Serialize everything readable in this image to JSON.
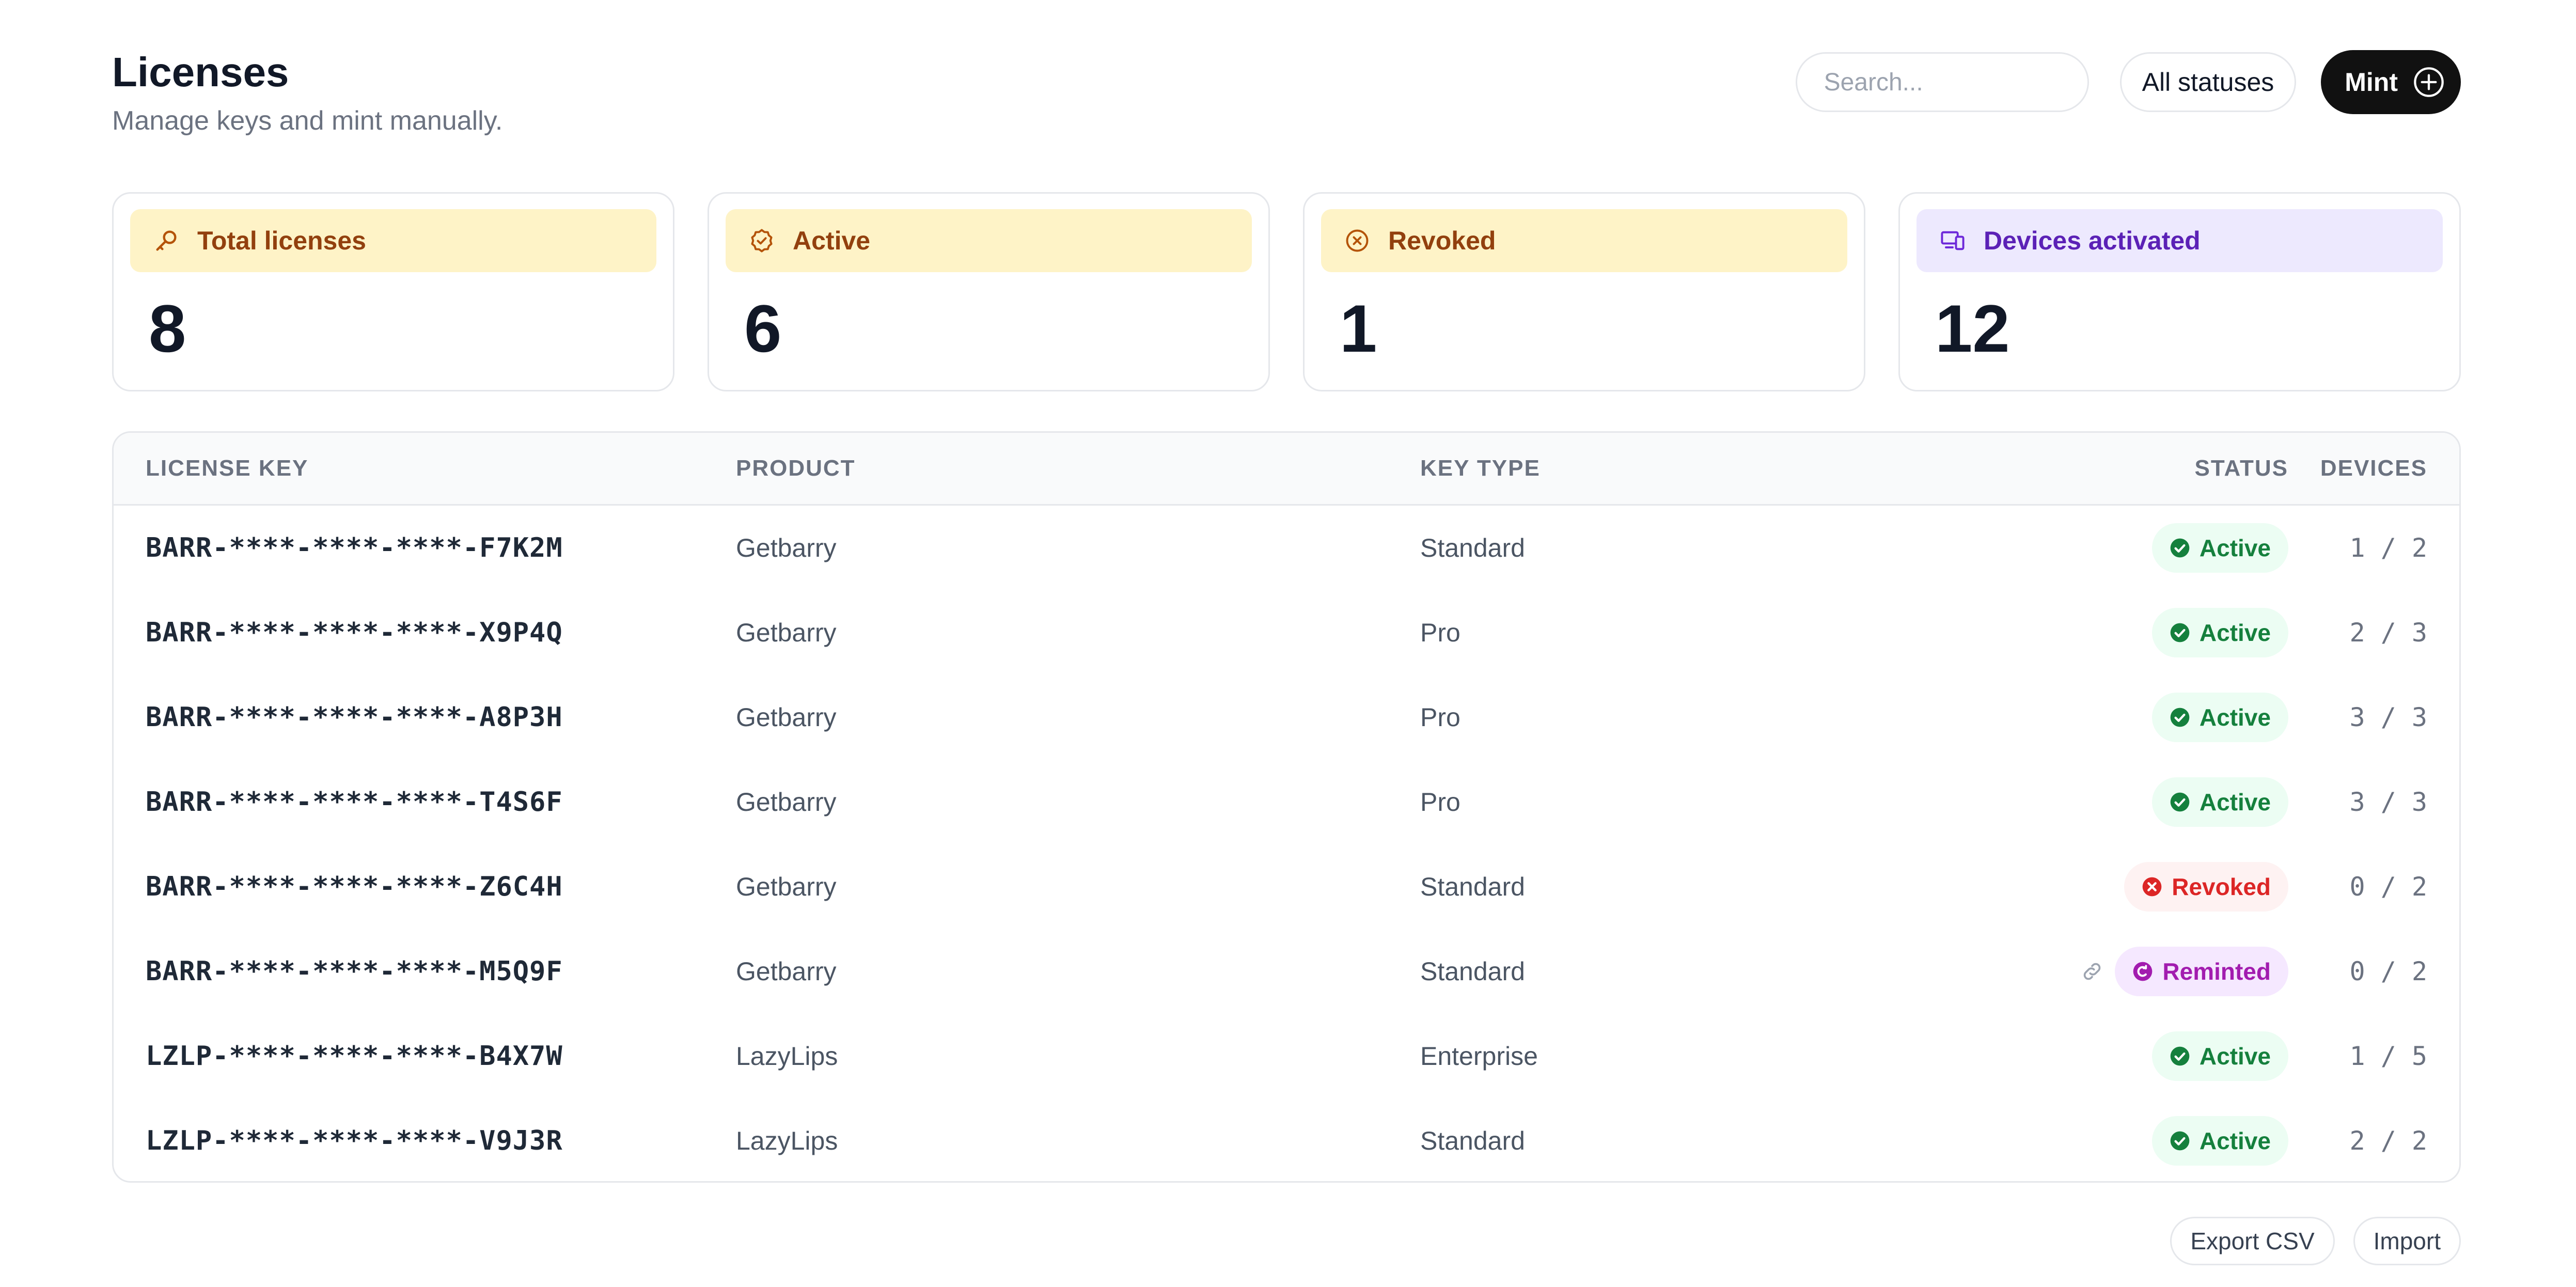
{
  "header": {
    "title": "Licenses",
    "subtitle": "Manage keys and mint manually."
  },
  "toolbar": {
    "search_placeholder": "Search...",
    "status_filter_label": "All statuses",
    "mint_label": "Mint"
  },
  "stats": [
    {
      "label": "Total licenses",
      "value": "8",
      "icon": "key-icon",
      "color": "#fef3c7"
    },
    {
      "label": "Active",
      "value": "6",
      "icon": "check-badge-icon",
      "color": "#fef3c7"
    },
    {
      "label": "Revoked",
      "value": "1",
      "icon": "x-circle-icon",
      "color": "#fef3c7"
    },
    {
      "label": "Devices activated",
      "value": "12",
      "icon": "devices-icon",
      "color": "#ede9fe"
    }
  ],
  "table": {
    "columns": {
      "key": "LICENSE KEY",
      "product": "PRODUCT",
      "type": "KEY TYPE",
      "status": "STATUS",
      "devices": "DEVICES"
    },
    "rows": [
      {
        "key": "BARR-****-****-****-F7K2M",
        "product": "Getbarry",
        "type": "Standard",
        "status": "Active",
        "devices": "1 / 2"
      },
      {
        "key": "BARR-****-****-****-X9P4Q",
        "product": "Getbarry",
        "type": "Pro",
        "status": "Active",
        "devices": "2 / 3"
      },
      {
        "key": "BARR-****-****-****-A8P3H",
        "product": "Getbarry",
        "type": "Pro",
        "status": "Active",
        "devices": "3 / 3"
      },
      {
        "key": "BARR-****-****-****-T4S6F",
        "product": "Getbarry",
        "type": "Pro",
        "status": "Active",
        "devices": "3 / 3"
      },
      {
        "key": "BARR-****-****-****-Z6C4H",
        "product": "Getbarry",
        "type": "Standard",
        "status": "Revoked",
        "devices": "0 / 2"
      },
      {
        "key": "BARR-****-****-****-M5Q9F",
        "product": "Getbarry",
        "type": "Standard",
        "status": "Reminted",
        "devices": "0 / 2",
        "has_link": true
      },
      {
        "key": "LZLP-****-****-****-B4X7W",
        "product": "LazyLips",
        "type": "Enterprise",
        "status": "Active",
        "devices": "1 / 5"
      },
      {
        "key": "LZLP-****-****-****-V9J3R",
        "product": "LazyLips",
        "type": "Standard",
        "status": "Active",
        "devices": "2 / 2"
      }
    ]
  },
  "footer": {
    "export_label": "Export CSV",
    "import_label": "Import"
  },
  "colors": {
    "active": "#15803d",
    "revoked": "#dc2626",
    "reminted": "#a21caf"
  }
}
